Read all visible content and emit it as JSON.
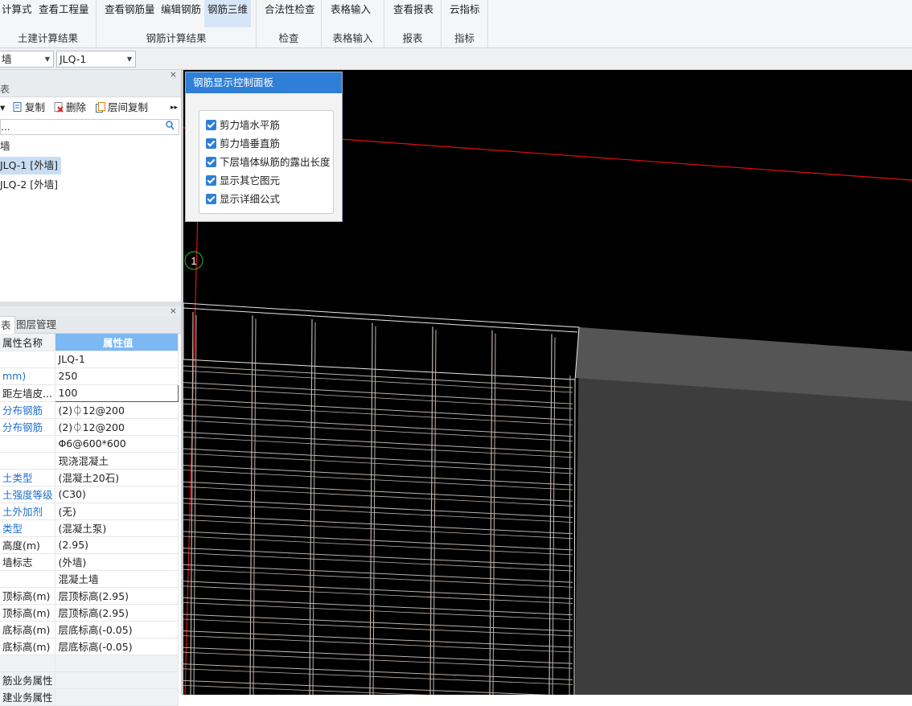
{
  "ribbon": {
    "groups": [
      {
        "label": "土建计算结果",
        "buttons": [
          "计算式",
          "查看工程量"
        ]
      },
      {
        "label": "钢筋计算结果",
        "buttons": [
          "查看钢筋量",
          "编辑钢筋",
          "钢筋三维"
        ]
      },
      {
        "label": "检查",
        "buttons": [
          "合法性检查"
        ]
      },
      {
        "label": "表格输入",
        "buttons": [
          "表格输入"
        ]
      },
      {
        "label": "报表",
        "buttons": [
          "查看报表"
        ]
      },
      {
        "label": "指标",
        "buttons": [
          "云指标"
        ]
      }
    ],
    "active_button": "钢筋三维"
  },
  "toolbar": {
    "combo_type": "墙",
    "combo_element": "JLQ-1"
  },
  "tree_panel": {
    "header": "表",
    "tools": [
      "复制",
      "删除",
      "层间复制"
    ],
    "search_text": "...",
    "items": [
      "墙",
      "JLQ-1 [外墙]",
      "JLQ-2 [外墙]"
    ],
    "selected_index": 1
  },
  "property_panel": {
    "tabs": [
      "表",
      "图层管理"
    ],
    "col_name": "属性名称",
    "col_value": "属性值",
    "rows": [
      {
        "name": "",
        "value": "JLQ-1",
        "blue": false
      },
      {
        "name": "mm)",
        "value": "250",
        "blue": true
      },
      {
        "name": "距左墙皮...",
        "value": "100",
        "blue": false
      },
      {
        "name": "分布钢筋",
        "value": "(2)⏀12@200",
        "blue": true
      },
      {
        "name": "分布钢筋",
        "value": "(2)⏀12@200",
        "blue": true
      },
      {
        "name": "",
        "value": "Φ6@600*600",
        "blue": false
      },
      {
        "name": "",
        "value": "现浇混凝土",
        "blue": false
      },
      {
        "name": "土类型",
        "value": "(混凝土20石)",
        "blue": true
      },
      {
        "name": "土强度等级",
        "value": "(C30)",
        "blue": true
      },
      {
        "name": "土外加剂",
        "value": "(无)",
        "blue": true
      },
      {
        "name": "类型",
        "value": "(混凝土泵)",
        "blue": true
      },
      {
        "name": "高度(m)",
        "value": "(2.95)",
        "blue": false
      },
      {
        "name": "墙标志",
        "value": "(外墙)",
        "blue": false
      },
      {
        "name": "",
        "value": "混凝土墙",
        "blue": false
      },
      {
        "name": "顶标高(m)",
        "value": "层顶标高(2.95)",
        "blue": false
      },
      {
        "name": "顶标高(m)",
        "value": "层顶标高(2.95)",
        "blue": false
      },
      {
        "name": "底标高(m)",
        "value": "层底标高(-0.05)",
        "blue": false
      },
      {
        "name": "底标高(m)",
        "value": "层底标高(-0.05)",
        "blue": false
      },
      {
        "name": "",
        "value": "",
        "blue": false
      },
      {
        "name": "筋业务属性",
        "value": "",
        "blue": false
      },
      {
        "name": "建业务属性",
        "value": "",
        "blue": false
      }
    ],
    "editing_index": 2
  },
  "control_panel": {
    "title": "钢筋显示控制面板",
    "options": [
      {
        "label": "剪力墙水平筋",
        "checked": true
      },
      {
        "label": "剪力墙垂直筋",
        "checked": true
      },
      {
        "label": "下层墙体纵筋的露出长度",
        "checked": true
      },
      {
        "label": "显示其它图元",
        "checked": true
      },
      {
        "label": "显示详细公式",
        "checked": true
      }
    ]
  },
  "viewport": {
    "axis_label": "1",
    "background": "#000000",
    "axis_color": "#e01010",
    "rebar_color": "#bdb3ad"
  }
}
